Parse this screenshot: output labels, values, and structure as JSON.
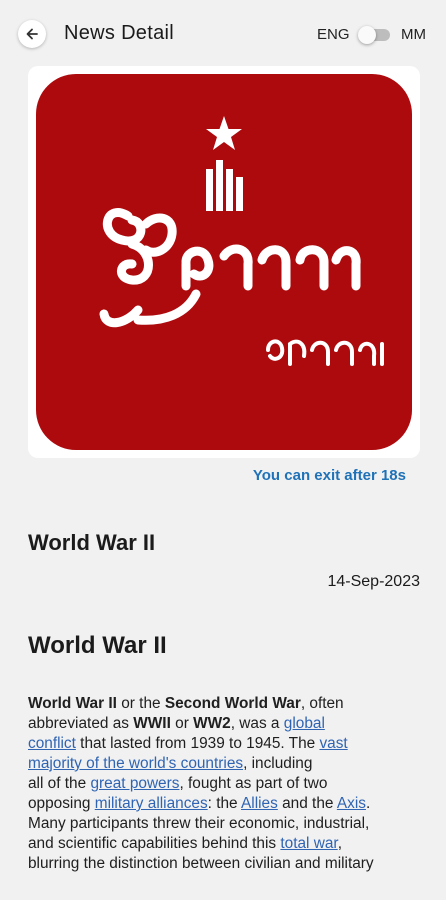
{
  "appbar": {
    "title": "News Detail",
    "back_icon": "arrow-left-icon",
    "lang_left": "ENG",
    "lang_right": "MM",
    "lang_toggle_on": false
  },
  "logo": {
    "background_color": "#ad0a0e",
    "foreground_color": "#ffffff"
  },
  "exit_timer": "You can exit after 18s",
  "news": {
    "title": "World War II",
    "date": "14-Sep-2023"
  },
  "article": {
    "heading": "World War II",
    "lines": [
      [
        {
          "t": "World War II",
          "b": true
        },
        {
          "t": " or the "
        },
        {
          "t": "Second World War",
          "b": true
        },
        {
          "t": ", often"
        }
      ],
      [
        {
          "t": "abbreviated as "
        },
        {
          "t": "WWII",
          "b": true
        },
        {
          "t": " or "
        },
        {
          "t": "WW2",
          "b": true
        },
        {
          "t": ", was a "
        },
        {
          "t": "global",
          "link": true
        }
      ],
      [
        {
          "t": "conflict",
          "link": true
        },
        {
          "t": " that lasted from 1939 to 1945. The "
        },
        {
          "t": "vast",
          "link": true
        }
      ],
      [
        {
          "t": "majority of the world's countries",
          "link": true
        },
        {
          "t": ", including"
        }
      ],
      [
        {
          "t": "all of the "
        },
        {
          "t": "great powers",
          "link": true
        },
        {
          "t": ", fought as part of two"
        }
      ],
      [
        {
          "t": "opposing "
        },
        {
          "t": "military alliances",
          "link": true
        },
        {
          "t": ": the "
        },
        {
          "t": "Allies",
          "link": true
        },
        {
          "t": " and the "
        },
        {
          "t": "Axis",
          "link": true
        },
        {
          "t": "."
        }
      ],
      [
        {
          "t": "Many participants threw their economic, industrial,"
        }
      ],
      [
        {
          "t": "and scientific capabilities behind this "
        },
        {
          "t": "total war",
          "link": true
        },
        {
          "t": ","
        }
      ],
      [
        {
          "t": "blurring the distinction between civilian and military"
        }
      ]
    ]
  }
}
